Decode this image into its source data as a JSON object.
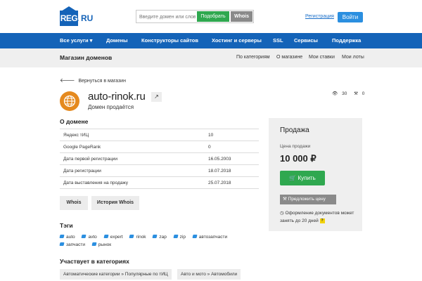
{
  "header": {
    "logo_text": "REG",
    "logo_dot": ".",
    "logo_suffix": "RU",
    "search_placeholder": "Введите домен или слово",
    "find_label": "Подобрать",
    "whois_label": "Whois",
    "register_label": "Регистрация",
    "login_label": "Войти"
  },
  "nav": {
    "items": [
      "Все услуги ▾",
      "Домены",
      "Конструкторы сайтов",
      "Хостинг и серверы",
      "SSL",
      "Сервисы",
      "Поддержка"
    ]
  },
  "subbar": {
    "title": "Магазин доменов",
    "links": [
      "По категориям",
      "О магазине",
      "Мои ставки",
      "Мои лоты"
    ]
  },
  "back_label": "Вернуться в магазин",
  "domain": {
    "name": "auto-rinok.ru",
    "status": "Домен продаётся",
    "views": "30",
    "bids": "0"
  },
  "about": {
    "title": "О домене",
    "rows": [
      {
        "label": "Яндекс тИЦ",
        "value": "10"
      },
      {
        "label": "Google PageRank",
        "value": "0"
      },
      {
        "label": "Дата первой регистрации",
        "value": "16.05.2003"
      },
      {
        "label": "Дата регистрации",
        "value": "18.07.2018"
      },
      {
        "label": "Дата выставления на продажу",
        "value": "25.07.2018"
      }
    ],
    "whois_button": "Whois",
    "history_button": "История Whois"
  },
  "tags": {
    "title": "Тэги",
    "items": [
      "auto",
      "avto",
      "expert",
      "rinok",
      "zap",
      "zip",
      "автозапчасти",
      "запчасти",
      "рынок"
    ]
  },
  "categories": {
    "title": "Участвует в категориях",
    "items": [
      "Автоматические категории » Популярные по тИЦ",
      "Авто и мото » Автомобили"
    ]
  },
  "sale": {
    "title": "Продажа",
    "price_label": "Цена продажи",
    "price": "10 000 ₽",
    "buy_label": "Купить",
    "offer_label": "Предложить цену",
    "note": "Оформление документов может занять до 20 дней",
    "note_q": "?"
  },
  "colors": {
    "brand_blue": "#1463b8",
    "green": "#2fa84f",
    "login_blue": "#2b8fe0",
    "domain_icon": "#e58a1f"
  }
}
